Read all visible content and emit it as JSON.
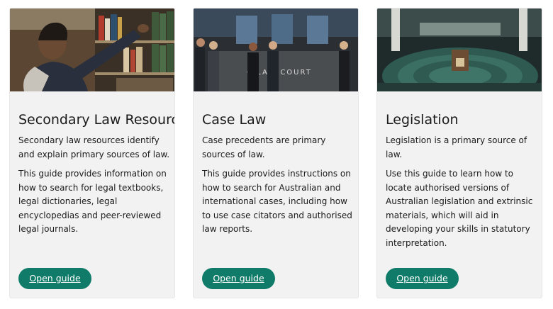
{
  "cards": [
    {
      "image_alt": "student-browsing-library-books",
      "title": "Secondary Law Resources",
      "paragraphs": [
        "Secondary law resources identify and explain primary sources of law.",
        "This guide provides information on how to search for legal textbooks, legal dictionaries, legal encyclopedias and peer-reviewed legal journals."
      ],
      "button_label": "Open guide"
    },
    {
      "image_alt": "people-outside-law-courts",
      "image_sign_text": "C  LAW COURT",
      "title": "Case Law",
      "paragraphs": [
        "Case precedents are primary sources of law.",
        "This guide provides instructions on how to search for Australian and international cases, including how to use case citators and authorised law reports."
      ],
      "button_label": "Open guide"
    },
    {
      "image_alt": "parliament-chamber",
      "title": "Legislation",
      "paragraphs": [
        "Legislation is a primary source of law.",
        "Use this guide to learn how to locate authorised versions of Australian legislation and extrinsic materials, which will aid in developing your skills in statutory interpretation."
      ],
      "button_label": "Open guide"
    }
  ],
  "colors": {
    "button": "#0f7b68",
    "card_background": "#f2f2f2",
    "text": "#1a1a1a"
  }
}
